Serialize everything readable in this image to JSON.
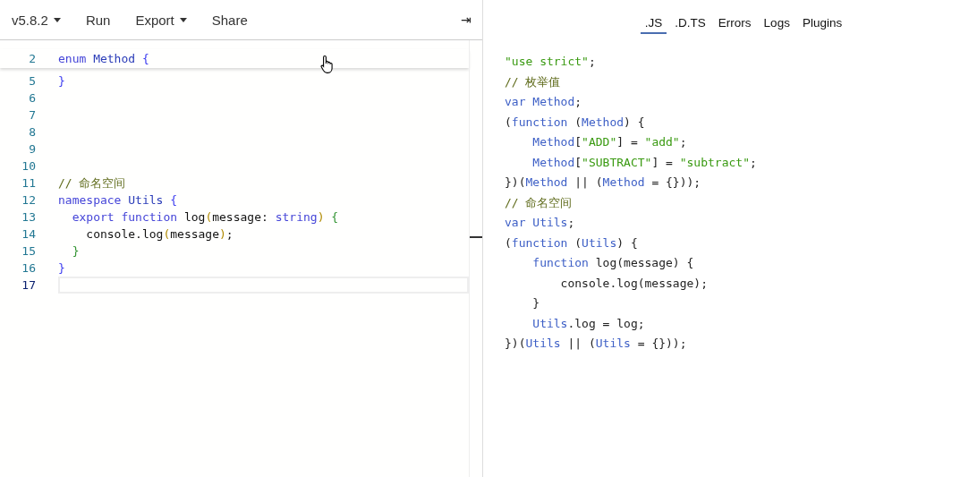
{
  "toolbar": {
    "items": [
      {
        "label": "v5.8.2",
        "dropdown": true
      },
      {
        "label": "Run",
        "dropdown": false
      },
      {
        "label": "Export",
        "dropdown": true
      },
      {
        "label": "Share",
        "dropdown": false
      }
    ],
    "collapse": "⇥"
  },
  "editor": {
    "sticky": {
      "number": "2",
      "tokens": [
        {
          "t": "enum ",
          "kind": "kw"
        },
        {
          "t": "Method ",
          "kind": "name"
        },
        {
          "t": "{",
          "kind": "brace"
        }
      ]
    },
    "lines": [
      {
        "number": "5",
        "current": false,
        "tokens": [
          {
            "t": "}",
            "kind": "brace"
          }
        ]
      },
      {
        "number": "6",
        "current": false
      },
      {
        "number": "7",
        "current": false
      },
      {
        "number": "8",
        "current": false
      },
      {
        "number": "9",
        "current": false
      },
      {
        "number": "10",
        "current": false
      },
      {
        "number": "11",
        "current": false,
        "tokens": [
          {
            "t": "// 命名空间",
            "kind": "comment"
          }
        ]
      },
      {
        "number": "12",
        "current": false,
        "tokens": [
          {
            "t": "namespace ",
            "kind": "kw"
          },
          {
            "t": "Utils ",
            "kind": "name"
          },
          {
            "t": "{",
            "kind": "brace"
          }
        ]
      },
      {
        "number": "13",
        "current": false,
        "tokens": [
          {
            "t": "  export function ",
            "kind": "kw"
          },
          {
            "t": "log",
            "kind": "plain"
          },
          {
            "t": "(",
            "kind": "paren"
          },
          {
            "t": "message: ",
            "kind": "plain"
          },
          {
            "t": "string",
            "kind": "kw"
          },
          {
            "t": ")",
            "kind": "paren"
          },
          {
            "t": " {",
            "kind": "brace2"
          }
        ]
      },
      {
        "number": "14",
        "current": false,
        "tokens": [
          {
            "t": "    console.log",
            "kind": "plain"
          },
          {
            "t": "(",
            "kind": "paren"
          },
          {
            "t": "message",
            "kind": "plain"
          },
          {
            "t": ")",
            "kind": "paren"
          },
          {
            "t": ";",
            "kind": "plain"
          }
        ]
      },
      {
        "number": "15",
        "current": false,
        "tokens": [
          {
            "t": "  }",
            "kind": "brace2"
          }
        ]
      },
      {
        "number": "16",
        "current": false,
        "tokens": [
          {
            "t": "}",
            "kind": "brace"
          }
        ]
      },
      {
        "number": "17",
        "current": true
      }
    ]
  },
  "tabs": [
    {
      "label": ".JS",
      "selected": true
    },
    {
      "label": ".D.TS",
      "selected": false
    },
    {
      "label": "Errors",
      "selected": false
    },
    {
      "label": "Logs",
      "selected": false
    },
    {
      "label": "Plugins",
      "selected": false
    }
  ],
  "output": [
    [
      {
        "t": "\"use strict\"",
        "kind": "str"
      },
      {
        "t": ";",
        "kind": "plain"
      }
    ],
    [
      {
        "t": "// 枚举值",
        "kind": "comment"
      }
    ],
    [
      {
        "t": "var ",
        "kind": "kw"
      },
      {
        "t": "Method",
        "kind": "name"
      },
      {
        "t": ";",
        "kind": "plain"
      }
    ],
    [
      {
        "t": "(",
        "kind": "plain"
      },
      {
        "t": "function ",
        "kind": "kw"
      },
      {
        "t": "(",
        "kind": "plain"
      },
      {
        "t": "Method",
        "kind": "name"
      },
      {
        "t": ") {",
        "kind": "plain"
      }
    ],
    [
      {
        "t": "    Method",
        "kind": "name"
      },
      {
        "t": "[",
        "kind": "plain"
      },
      {
        "t": "\"ADD\"",
        "kind": "str"
      },
      {
        "t": "] = ",
        "kind": "plain"
      },
      {
        "t": "\"add\"",
        "kind": "str"
      },
      {
        "t": ";",
        "kind": "plain"
      }
    ],
    [
      {
        "t": "    Method",
        "kind": "name"
      },
      {
        "t": "[",
        "kind": "plain"
      },
      {
        "t": "\"SUBTRACT\"",
        "kind": "str"
      },
      {
        "t": "] = ",
        "kind": "plain"
      },
      {
        "t": "\"subtract\"",
        "kind": "str"
      },
      {
        "t": ";",
        "kind": "plain"
      }
    ],
    [
      {
        "t": "})(",
        "kind": "plain"
      },
      {
        "t": "Method",
        "kind": "name"
      },
      {
        "t": " || (",
        "kind": "plain"
      },
      {
        "t": "Method",
        "kind": "name"
      },
      {
        "t": " = {}));",
        "kind": "plain"
      }
    ],
    [
      {
        "t": "// 命名空间",
        "kind": "comment"
      }
    ],
    [
      {
        "t": "var ",
        "kind": "kw"
      },
      {
        "t": "Utils",
        "kind": "name"
      },
      {
        "t": ";",
        "kind": "plain"
      }
    ],
    [
      {
        "t": "(",
        "kind": "plain"
      },
      {
        "t": "function ",
        "kind": "kw"
      },
      {
        "t": "(",
        "kind": "plain"
      },
      {
        "t": "Utils",
        "kind": "name"
      },
      {
        "t": ") {",
        "kind": "plain"
      }
    ],
    [
      {
        "t": "    function ",
        "kind": "kw"
      },
      {
        "t": "log(message) {",
        "kind": "plain"
      }
    ],
    [
      {
        "t": "        console.log(message);",
        "kind": "plain"
      }
    ],
    [
      {
        "t": "    }",
        "kind": "plain"
      }
    ],
    [
      {
        "t": "    Utils",
        "kind": "name"
      },
      {
        "t": ".log = log;",
        "kind": "plain"
      }
    ],
    [
      {
        "t": "})(",
        "kind": "plain"
      },
      {
        "t": "Utils",
        "kind": "name"
      },
      {
        "t": " || (",
        "kind": "plain"
      },
      {
        "t": "Utils",
        "kind": "name"
      },
      {
        "t": " = {}));",
        "kind": "plain"
      }
    ]
  ]
}
